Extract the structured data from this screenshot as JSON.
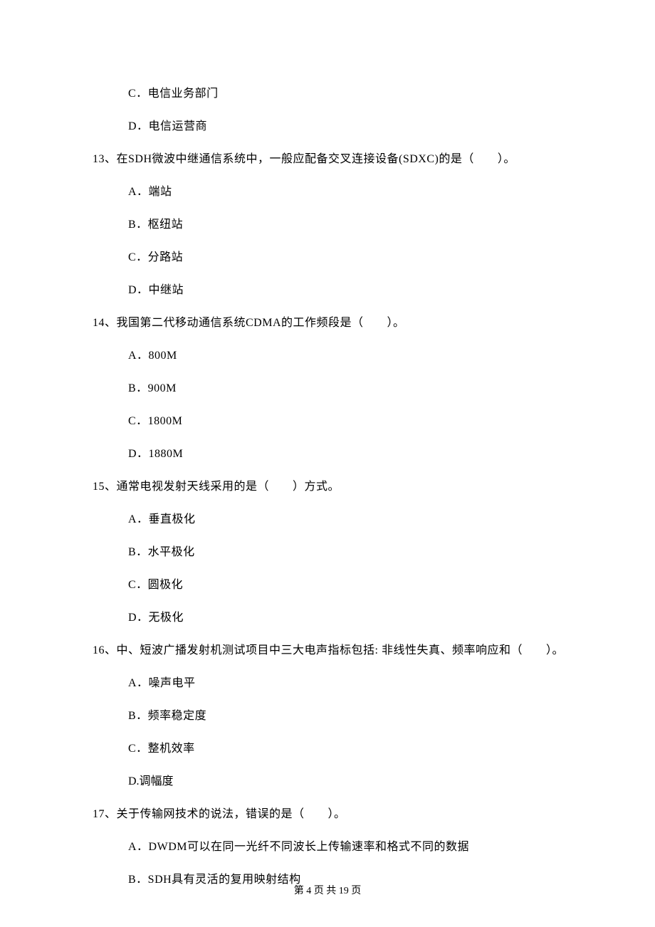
{
  "orphan_options": [
    "C．电信业务部门",
    "D．电信运营商"
  ],
  "questions": [
    {
      "num": "13",
      "text": "13、在SDH微波中继通信系统中，一般应配备交叉连接设备(SDXC)的是（　　）。",
      "options": [
        "A．端站",
        "B．枢纽站",
        "C．分路站",
        "D．中继站"
      ]
    },
    {
      "num": "14",
      "text": "14、我国第二代移动通信系统CDMA的工作频段是（　　）。",
      "options": [
        "A．800M",
        "B．900M",
        "C．1800M",
        "D．1880M"
      ]
    },
    {
      "num": "15",
      "text": "15、通常电视发射天线采用的是（　　）方式。",
      "options": [
        "A．垂直极化",
        "B．水平极化",
        "C．圆极化",
        "D．无极化"
      ]
    },
    {
      "num": "16",
      "text": "16、中、短波广播发射机测试项目中三大电声指标包括: 非线性失真、频率响应和（　　）。",
      "options": [
        "A．噪声电平",
        "B．频率稳定度",
        "C．整机效率",
        "D.调幅度"
      ]
    },
    {
      "num": "17",
      "text": "17、关于传输网技术的说法，错误的是（　　）。",
      "options": [
        "A．DWDM可以在同一光纤不同波长上传输速率和格式不同的数据",
        "B．SDH具有灵活的复用映射结构"
      ]
    }
  ],
  "footer": "第 4 页 共 19 页"
}
